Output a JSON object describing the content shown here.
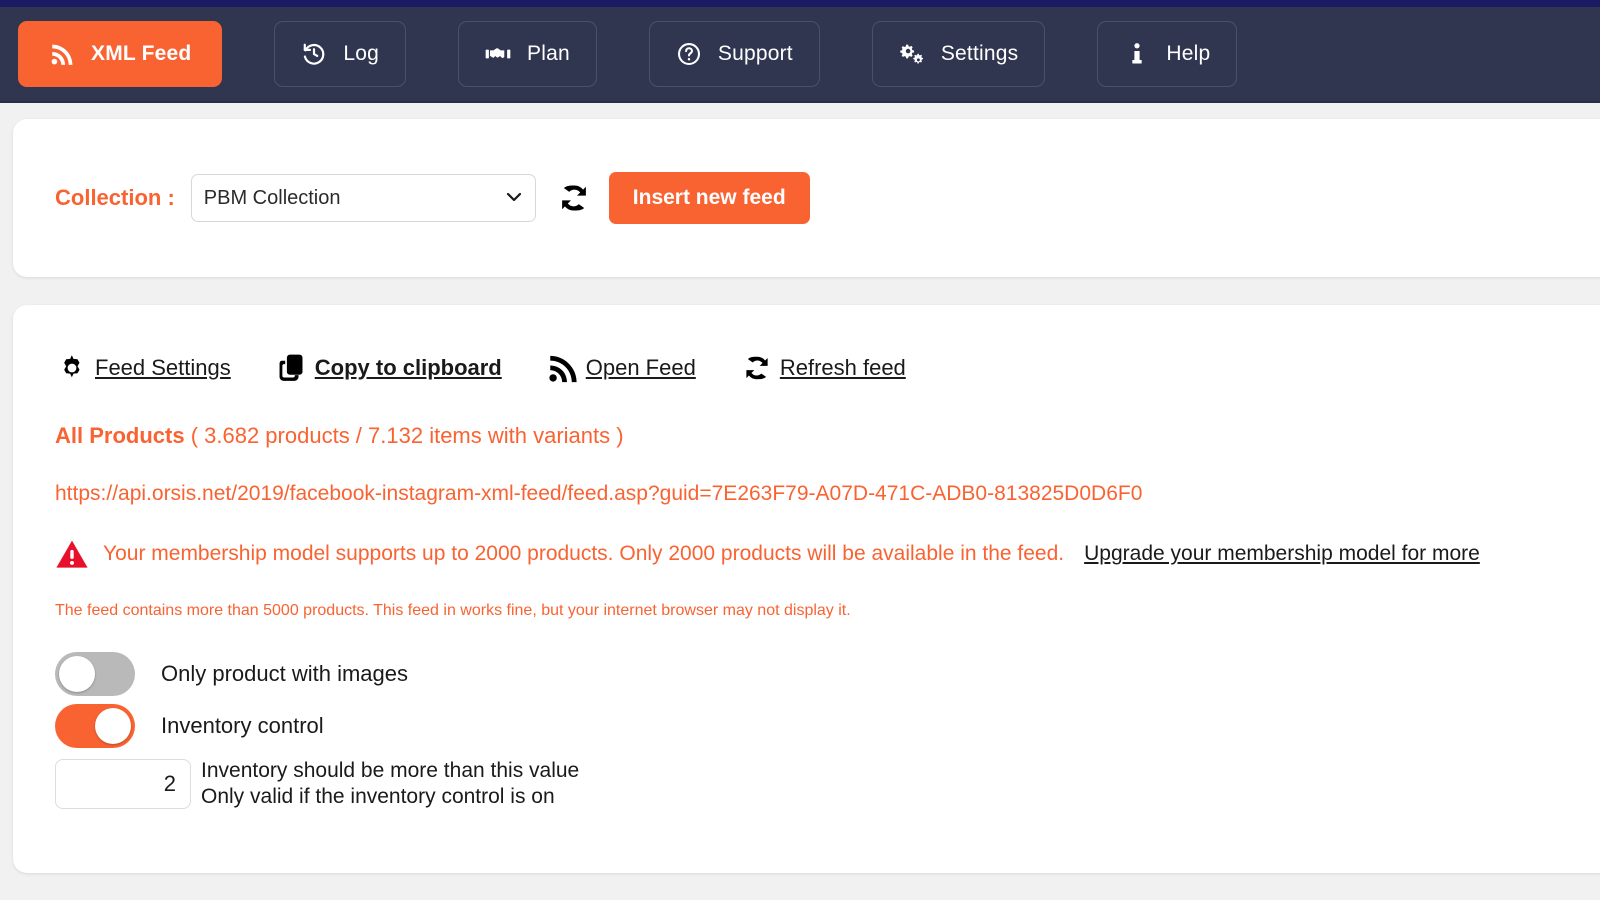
{
  "theme": {
    "accent": "#f96332",
    "navbar_bg": "#313650",
    "top_strip": "#1b1b63",
    "page_bg": "#f1f1f1",
    "warning_red": "#e8112d",
    "toggle_off": "#b9b9b9"
  },
  "navbar": {
    "items": [
      {
        "label": "XML Feed",
        "icon": "rss-icon",
        "active": true
      },
      {
        "label": "Log",
        "icon": "history-icon",
        "active": false
      },
      {
        "label": "Plan",
        "icon": "handshake-icon",
        "active": false
      },
      {
        "label": "Support",
        "icon": "question-circle-icon",
        "active": false
      },
      {
        "label": "Settings",
        "icon": "gears-icon",
        "active": false
      },
      {
        "label": "Help",
        "icon": "info-icon",
        "active": false
      }
    ]
  },
  "collection_bar": {
    "label": "Collection :",
    "selected": "PBM Collection",
    "options": [
      "PBM Collection"
    ],
    "refresh_icon": "refresh-icon",
    "insert_button": "Insert new feed"
  },
  "feed_panel": {
    "actions": [
      {
        "label": "Feed Settings",
        "icon": "gear-icon",
        "bold": false
      },
      {
        "label": "Copy to clipboard",
        "icon": "clipboard-copy-icon",
        "bold": true
      },
      {
        "label": "Open Feed",
        "icon": "rss-icon",
        "bold": false
      },
      {
        "label": "Refresh feed",
        "icon": "refresh-icon",
        "bold": false
      }
    ],
    "products_title": "All Products",
    "products_count": "( 3.682 products / 7.132 items with variants )",
    "feed_url": "https://api.orsis.net/2019/facebook-instagram-xml-feed/feed.asp?guid=7E263F79-A07D-471C-ADB0-813825D0D6F0",
    "warning_icon": "warning-triangle-icon",
    "warning_text": "Your membership model supports up to 2000 products. Only 2000 products will be available in the feed.",
    "upgrade_link": "Upgrade your membership model for more",
    "feed_note": "The feed contains more than 5000 products. This feed in works fine, but your internet browser may not display it.",
    "toggles": [
      {
        "label": "Only product with images",
        "on": false
      },
      {
        "label": "Inventory control",
        "on": true
      }
    ],
    "inventory_value": "2",
    "inventory_hint_line1": "Inventory should be more than this value",
    "inventory_hint_line2": "Only valid if the inventory control is on"
  }
}
